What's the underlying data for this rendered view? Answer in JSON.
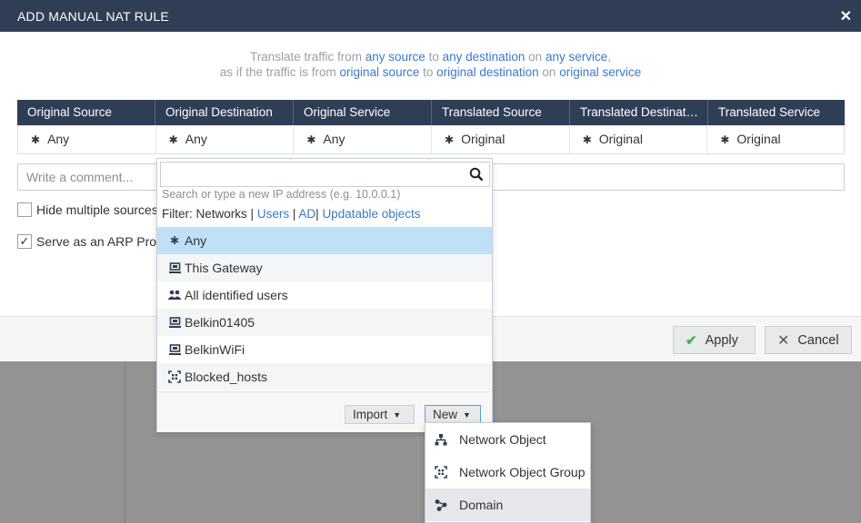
{
  "dialog": {
    "title": "ADD MANUAL NAT RULE",
    "close": "✕"
  },
  "description": {
    "line1": {
      "p1": "Translate traffic from ",
      "l1": "any source",
      "p2": " to ",
      "l2": "any destination",
      "p3": " on ",
      "l3": "any service",
      "p4": ","
    },
    "line2": {
      "p1": "as if the traffic is from ",
      "l1": "original source",
      "p2": " to ",
      "l2": "original destination",
      "p3": " on ",
      "l3": "original service"
    }
  },
  "grid": {
    "headers": [
      "Original Source",
      "Original Destination",
      "Original Service",
      "Translated Source",
      "Translated Destinat…",
      "Translated Service"
    ],
    "values": [
      "Any",
      "Any",
      "Any",
      "Original",
      "Original",
      "Original"
    ],
    "asterisk": "✱"
  },
  "comment": {
    "placeholder": "Write a comment..."
  },
  "options": {
    "hide_multiple": {
      "label": "Hide multiple sources",
      "checked": false
    },
    "arp_proxy": {
      "label": "Serve as an ARP Proxy",
      "checked": true,
      "mark": "✓"
    }
  },
  "footer": {
    "apply": "Apply",
    "apply_icon": "✔",
    "cancel": "Cancel",
    "cancel_icon": "✕"
  },
  "picker": {
    "hint": "Search or type a new IP address (e.g. 10.0.0.1)",
    "filter_label": "Filter:",
    "filter_active": "Networks",
    "filter_sep": "|",
    "filter_links": [
      "Users",
      "AD",
      "Updatable objects"
    ],
    "items": [
      {
        "label": "Any",
        "icon": "asterisk-icon",
        "glyph": "✱"
      },
      {
        "label": "This Gateway",
        "icon": "gateway-icon",
        "glyph": "▣"
      },
      {
        "label": "All identified users",
        "icon": "users-icon",
        "glyph": "👥"
      },
      {
        "label": "Belkin01405",
        "icon": "gateway-icon",
        "glyph": "▣"
      },
      {
        "label": "BelkinWiFi",
        "icon": "gateway-icon",
        "glyph": "▣"
      },
      {
        "label": "Blocked_hosts",
        "icon": "network-group-icon",
        "glyph": "⛶"
      }
    ],
    "import": "Import",
    "new": "New",
    "caret": "▼"
  },
  "new_menu": {
    "items": [
      {
        "label": "Network Object",
        "icon": "network-object-icon"
      },
      {
        "label": "Network Object Group",
        "icon": "network-group-icon"
      },
      {
        "label": "Domain",
        "icon": "domain-icon"
      }
    ]
  },
  "colors": {
    "header": "#2f3e54",
    "link": "#3b7ac8",
    "selected": "#bfe0f7",
    "apply_check": "#4caf50"
  }
}
